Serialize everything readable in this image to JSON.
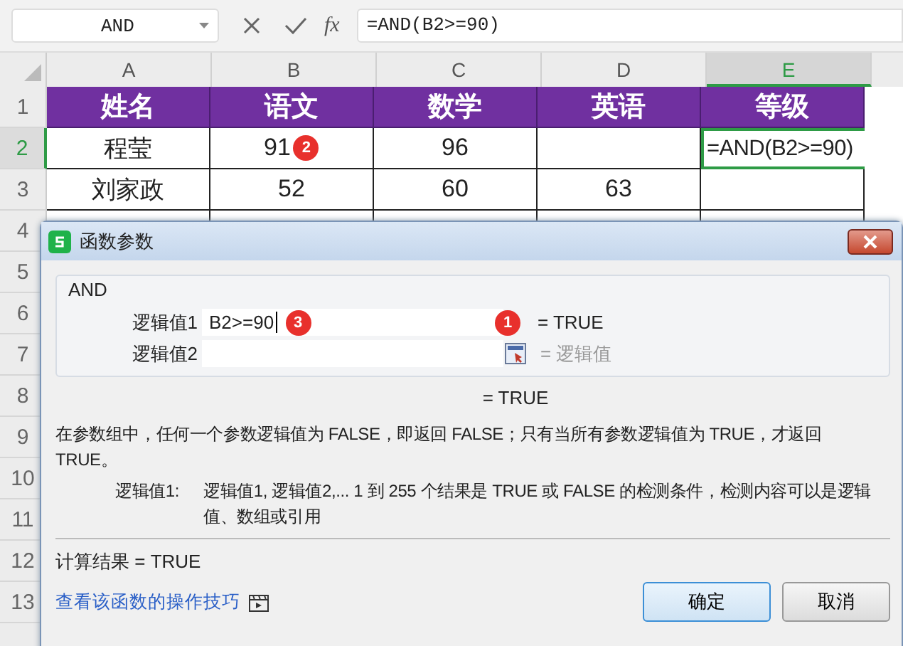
{
  "name_box": {
    "value": "AND"
  },
  "formula_bar": {
    "fx": "fx",
    "value": "=AND(B2>=90)"
  },
  "columns": [
    {
      "label": "A",
      "selected": false
    },
    {
      "label": "B",
      "selected": false
    },
    {
      "label": "C",
      "selected": false
    },
    {
      "label": "D",
      "selected": false
    },
    {
      "label": "E",
      "selected": true
    }
  ],
  "rows": [
    {
      "number": "1",
      "selected": false,
      "kind": "header",
      "cells": [
        "姓名",
        "语文",
        "数学",
        "英语",
        "等级"
      ]
    },
    {
      "number": "2",
      "selected": true,
      "kind": "data",
      "cells": [
        "程莹",
        "91",
        "96",
        "",
        "=AND(B2>=90)"
      ]
    },
    {
      "number": "3",
      "selected": false,
      "kind": "data",
      "cells": [
        "刘家政",
        "52",
        "60",
        "63",
        ""
      ]
    },
    {
      "number": "4",
      "selected": false,
      "kind": "data",
      "cells": [
        "",
        "",
        "",
        "",
        ""
      ]
    },
    {
      "number": "5",
      "selected": false,
      "kind": "blank",
      "cells": []
    },
    {
      "number": "6",
      "selected": false,
      "kind": "blank",
      "cells": []
    },
    {
      "number": "7",
      "selected": false,
      "kind": "blank",
      "cells": []
    },
    {
      "number": "8",
      "selected": false,
      "kind": "blank",
      "cells": []
    },
    {
      "number": "9",
      "selected": false,
      "kind": "blank",
      "cells": []
    },
    {
      "number": "10",
      "selected": false,
      "kind": "blank",
      "cells": []
    },
    {
      "number": "11",
      "selected": false,
      "kind": "blank",
      "cells": []
    },
    {
      "number": "12",
      "selected": false,
      "kind": "blank",
      "cells": []
    },
    {
      "number": "13",
      "selected": false,
      "kind": "blank",
      "cells": []
    }
  ],
  "cell_badge": {
    "text": "2"
  },
  "dialog": {
    "title": "函数参数",
    "function_name": "AND",
    "args": [
      {
        "label": "逻辑值1",
        "value": "B2>=90",
        "badge": "3",
        "button_badge": "1",
        "result": "=  TRUE",
        "result_placeholder": false
      },
      {
        "label": "逻辑值2",
        "result": "=  逻辑值",
        "result_placeholder": true
      }
    ],
    "total": "=  TRUE",
    "description": "在参数组中，任何一个参数逻辑值为 FALSE，即返回 FALSE；只有当所有参数逻辑值为 TRUE，才返回 TRUE。",
    "arg_help": {
      "label": "逻辑值1:",
      "text": "逻辑值1, 逻辑值2,... 1 到 255 个结果是 TRUE 或 FALSE 的检测条件，检测内容可以是逻辑值、数组或引用"
    },
    "calc_result": "计算结果  =  TRUE",
    "help_link": "查看该函数的操作技巧",
    "buttons": [
      {
        "label": "确定",
        "default": true
      },
      {
        "label": "取消",
        "default": false
      }
    ]
  }
}
